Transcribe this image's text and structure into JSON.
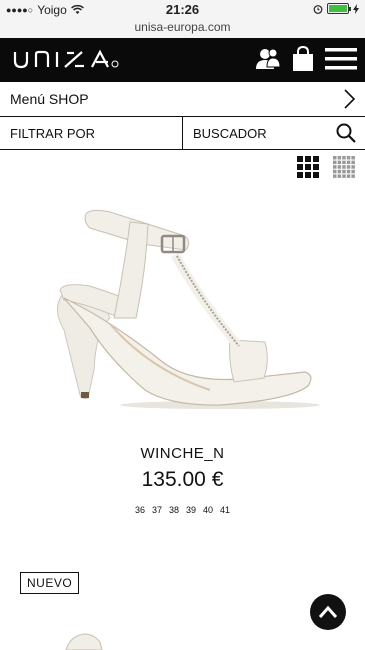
{
  "status": {
    "carrier": "Yoigo",
    "time": "21:26",
    "url": "unisa-europa.com"
  },
  "brand": {
    "logo_text": "UNISA"
  },
  "nav": {
    "menu_label": "Menú SHOP",
    "filter_label": "FILTRAR POR",
    "search_label": "BUSCADOR"
  },
  "product": {
    "name": "WINCHE_N",
    "price": "135.00 €",
    "sizes": [
      "36",
      "37",
      "38",
      "39",
      "40",
      "41"
    ]
  },
  "badge": {
    "label": "NUEVO"
  },
  "icons": {
    "account": "user-icon",
    "bag": "shopping-bag-icon",
    "menu": "hamburger-icon",
    "search": "search-icon",
    "grid_large": "grid-large-icon",
    "grid_small": "grid-small-icon",
    "scroll_top": "chevron-up-icon"
  },
  "colors": {
    "topbar": "#0a0a0a",
    "battery": "#3ec13e"
  }
}
